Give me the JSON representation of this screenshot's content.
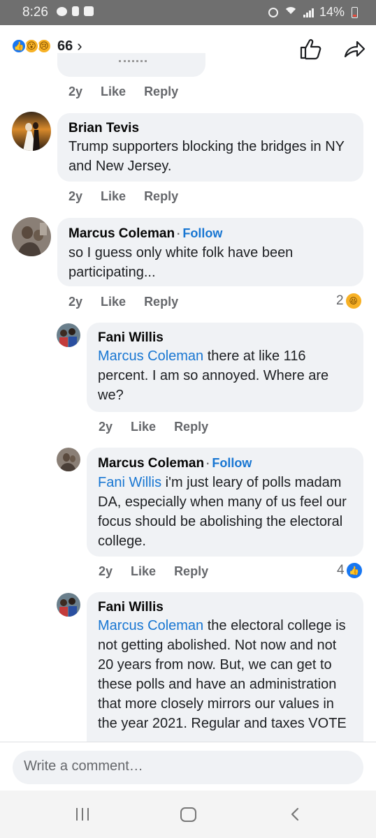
{
  "status_bar": {
    "time": "8:26",
    "battery": "14%"
  },
  "header": {
    "reaction_count": "66",
    "chevron": "›"
  },
  "comments": [
    {
      "actions": {
        "time": "2y",
        "like": "Like",
        "reply": "Reply"
      }
    },
    {
      "name": "Brian Tevis",
      "text": "Trump supporters blocking the bridges in NY and New Jersey.",
      "actions": {
        "time": "2y",
        "like": "Like",
        "reply": "Reply"
      }
    },
    {
      "name": "Marcus Coleman",
      "follow": "Follow",
      "text": "so I guess only white folk have been participating...",
      "actions": {
        "time": "2y",
        "like": "Like",
        "reply": "Reply"
      },
      "reaction_count": "2"
    },
    {
      "name": "Fani Willis",
      "mention": "Marcus Coleman",
      "text": " there at like 116 percent. I am so annoyed.  Where are we?",
      "actions": {
        "time": "2y",
        "like": "Like",
        "reply": "Reply"
      }
    },
    {
      "name": "Marcus Coleman",
      "follow": "Follow",
      "mention": "Fani Willis",
      "text": " i'm just leary of polls madam DA, especially when many of us feel our focus should be abolishing the electoral college.",
      "actions": {
        "time": "2y",
        "like": "Like",
        "reply": "Reply"
      },
      "reaction_count": "4"
    },
    {
      "name": "Fani Willis",
      "mention": "Marcus Coleman",
      "text": " the electoral college is not getting abolished. Not now and not 20 years from now. But, we can get to these polls and have an administration that more closely mirrors our values in the year 2021.  Regular and taxes VOTE"
    }
  ],
  "write_comment": {
    "placeholder": "Write a comment…"
  }
}
